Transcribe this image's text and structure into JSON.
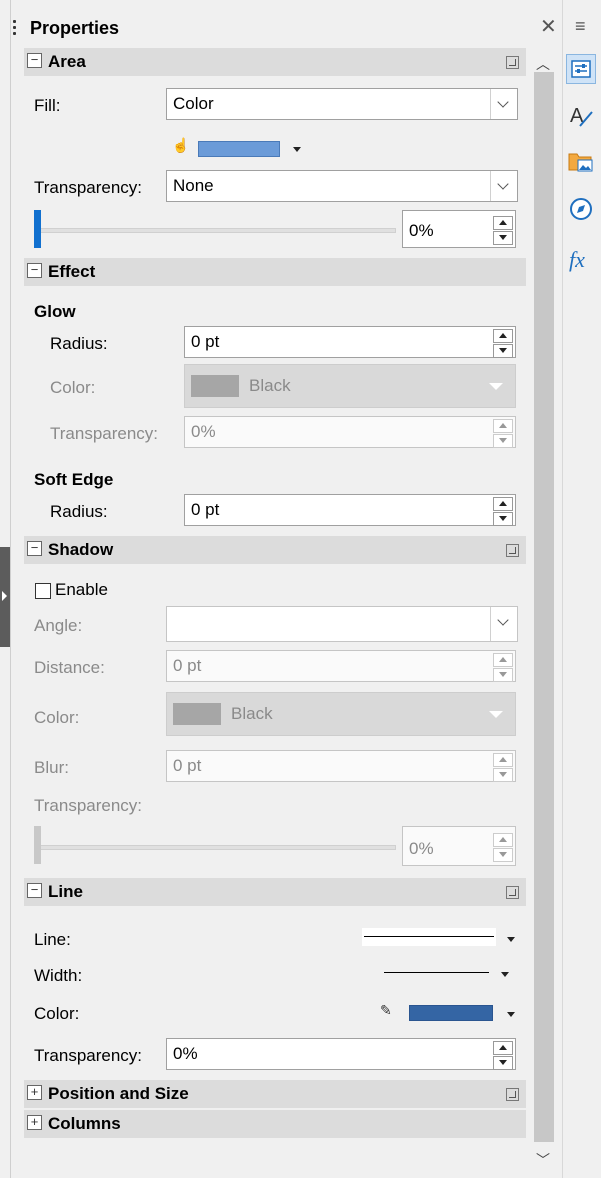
{
  "title": "Properties",
  "sections": {
    "area": {
      "title": "Area",
      "fill_label": "Fill:",
      "fill_value": "Color",
      "transparency_label": "Transparency:",
      "transparency_value": "None",
      "transparency_percent": "0%"
    },
    "effect": {
      "title": "Effect",
      "glow_title": "Glow",
      "glow_radius_label": "Radius:",
      "glow_radius_value": "0 pt",
      "glow_color_label": "Color:",
      "glow_color_value": "Black",
      "glow_transparency_label": "Transparency:",
      "glow_transparency_value": "0%",
      "soft_edge_title": "Soft Edge",
      "soft_radius_label": "Radius:",
      "soft_radius_value": "0 pt"
    },
    "shadow": {
      "title": "Shadow",
      "enable_label": "Enable",
      "angle_label": "Angle:",
      "angle_value": "",
      "distance_label": "Distance:",
      "distance_value": "0 pt",
      "color_label": "Color:",
      "color_value": "Black",
      "blur_label": "Blur:",
      "blur_value": "0 pt",
      "transparency_label": "Transparency:",
      "transparency_value": "0%"
    },
    "line": {
      "title": "Line",
      "line_label": "Line:",
      "width_label": "Width:",
      "color_label": "Color:",
      "transparency_label": "Transparency:",
      "transparency_value": "0%"
    },
    "position_size": {
      "title": "Position and Size"
    },
    "columns": {
      "title": "Columns"
    }
  },
  "colors": {
    "fill_color": "#6b9bd8",
    "line_color": "#3465a4",
    "slider_accent": "#1170cf",
    "disabled_swatch": "#a6a6a6"
  },
  "sidebar_icons": [
    "properties-icon",
    "styles-icon",
    "gallery-icon",
    "navigator-icon",
    "functions-icon"
  ]
}
